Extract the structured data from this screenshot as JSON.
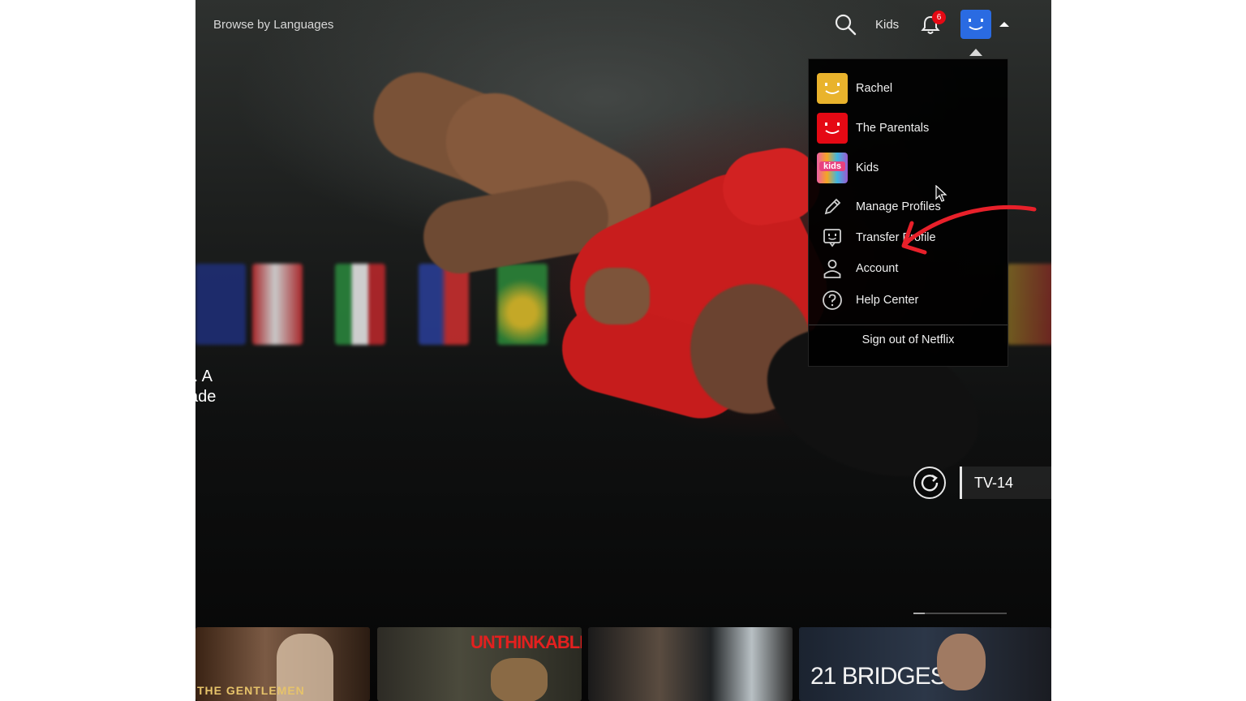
{
  "header": {
    "browse_label": "Browse by Languages",
    "kids_label": "Kids",
    "notification_count": "6",
    "avatar_color": "#2a6be2"
  },
  "hero": {
    "partial_text_line1": "t. A",
    "partial_text_line2": "ade",
    "maturity_rating": "TV-14"
  },
  "profile_menu": {
    "profiles": [
      {
        "name": "Rachel",
        "color": "#e9b32c"
      },
      {
        "name": "The Parentals",
        "color": "#e50914"
      },
      {
        "name": "Kids",
        "color": "#f05fa3",
        "badge": "kids"
      }
    ],
    "items": [
      {
        "label": "Manage Profiles",
        "icon": "pencil-icon"
      },
      {
        "label": "Transfer Profile",
        "icon": "transfer-profile-icon"
      },
      {
        "label": "Account",
        "icon": "person-icon"
      },
      {
        "label": "Help Center",
        "icon": "question-circle-icon"
      }
    ],
    "sign_out_label": "Sign out of Netflix"
  },
  "thumbnails": [
    {
      "title": "THE GENTLEMEN"
    },
    {
      "title": "UNTHINKABLE"
    },
    {
      "title": ""
    },
    {
      "title": "21 BRIDGES"
    }
  ],
  "colors": {
    "brand_red": "#e50914",
    "annotation_arrow": "#e8202a"
  }
}
